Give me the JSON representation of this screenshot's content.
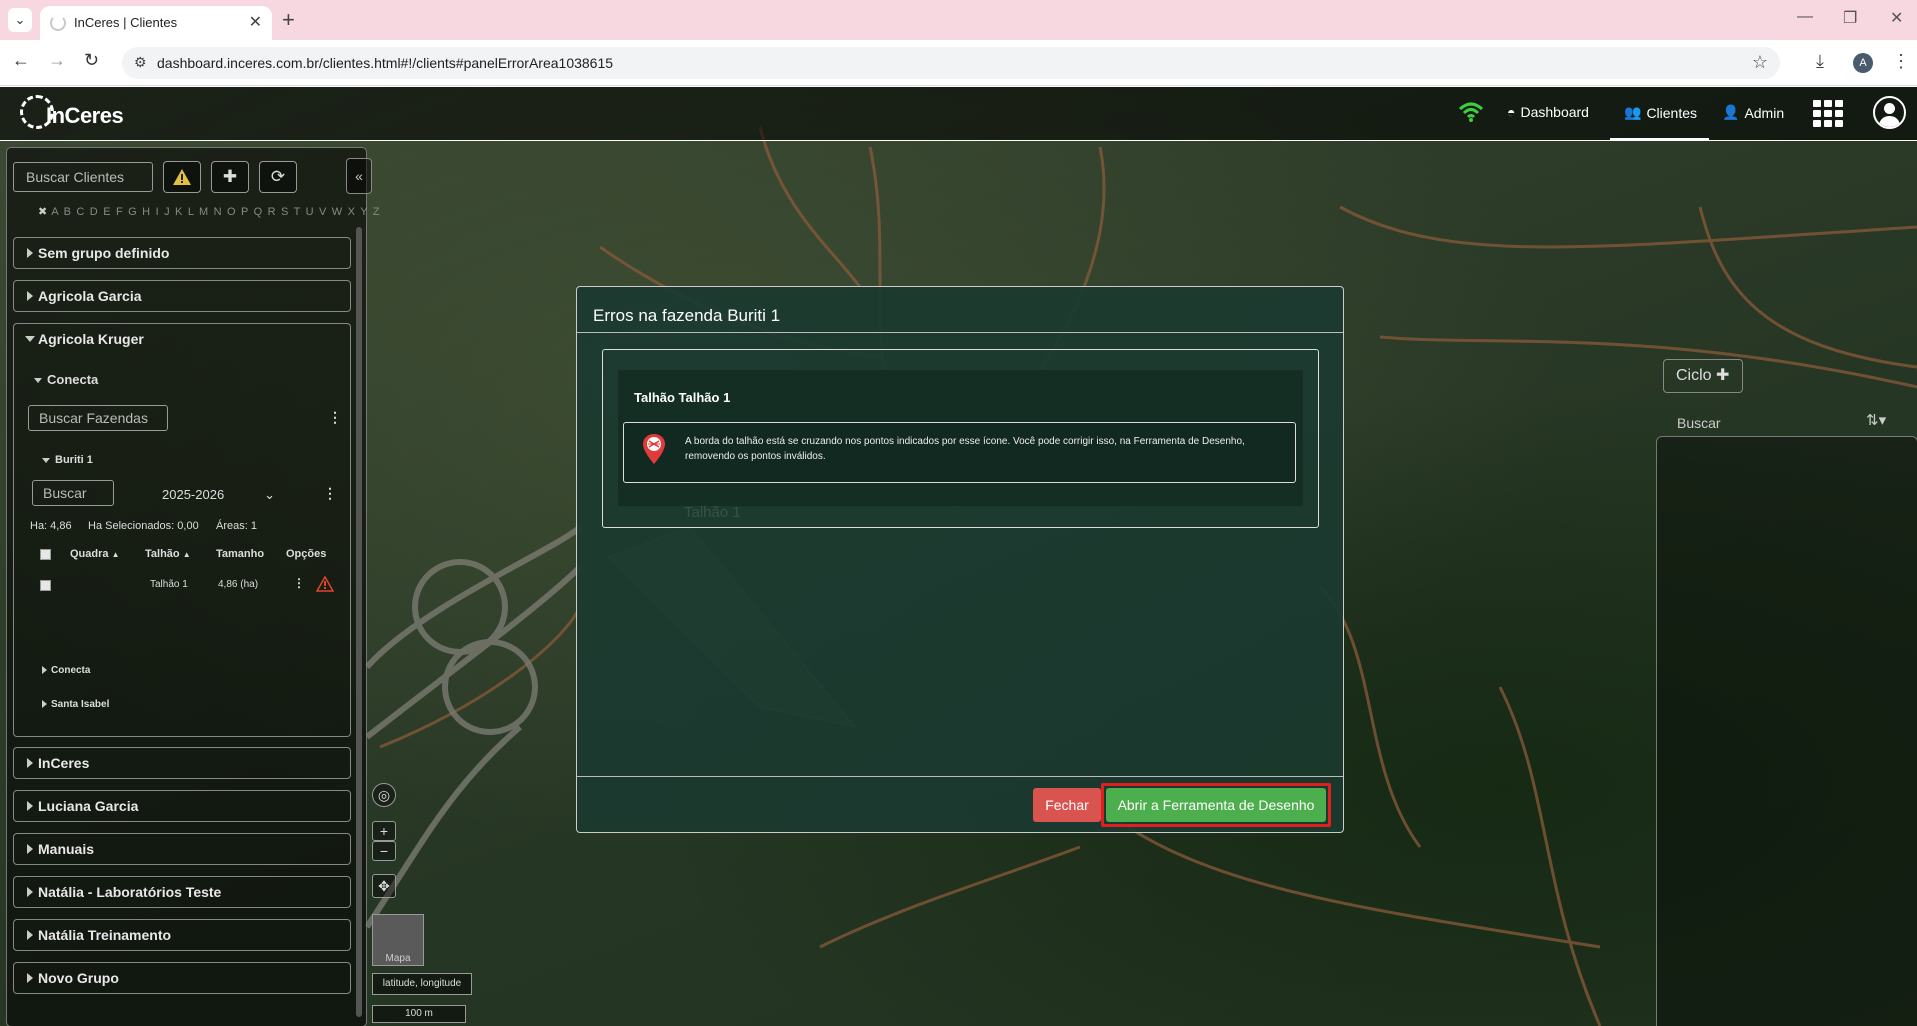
{
  "browser": {
    "tab_title": "InCeres | Clientes",
    "url": "dashboard.inceres.com.br/clientes.html#!/clients#panelErrorArea1038615",
    "profile_initial": "A"
  },
  "app": {
    "logo_text": "InCeres",
    "nav": {
      "dashboard": "Dashboard",
      "clientes": "Clientes",
      "admin": "Admin"
    }
  },
  "sidebar": {
    "search_placeholder": "Buscar Clientes",
    "alphabet": "A B C D E F G H I J K L M N O P Q R S T U V W X Y Z",
    "groups": [
      {
        "label": "Sem grupo definido"
      },
      {
        "label": "Agricola Garcia"
      },
      {
        "label": "Agricola Kruger"
      },
      {
        "label": "InCeres"
      },
      {
        "label": "Luciana Garcia"
      },
      {
        "label": "Manuais"
      },
      {
        "label": "Natália - Laboratórios Teste"
      },
      {
        "label": "Natália Treinamento"
      },
      {
        "label": "Novo Grupo"
      }
    ],
    "open_group": {
      "subgroup": "Conecta",
      "farm_search_placeholder": "Buscar Fazendas",
      "farm": "Buriti 1",
      "area_search_placeholder": "Buscar",
      "season": "2025-2026",
      "stats": {
        "ha": "Ha: 4,86",
        "ha_selected": "Ha Selecionados: 0,00",
        "areas": "Áreas: 1"
      },
      "columns": [
        "Quadra",
        "Talhão",
        "Tamanho",
        "Opções"
      ],
      "rows": [
        {
          "quadra": "",
          "talhao": "Talhão 1",
          "tamanho": "4,86 (ha)"
        }
      ],
      "other_farms": [
        "Conecta",
        "Santa Isabel"
      ]
    }
  },
  "right_panel": {
    "ciclo_label": "Ciclo",
    "search_placeholder": "Buscar"
  },
  "map": {
    "layer_label": "Mapa",
    "coords_label": "latitude, longitude",
    "scale_label": "100 m"
  },
  "modal": {
    "title": "Erros na fazenda Buriti 1",
    "field_title": "Talhão Talhão 1",
    "message": "A borda do talhão está se cruzando nos pontos indicados por esse ícone. Você pode corrigir isso, na Ferramenta de Desenho, removendo os pontos inválidos.",
    "background_label": "Talhão 1",
    "close_button": "Fechar",
    "draw_button": "Abrir a Ferramenta de Desenho"
  },
  "colors": {
    "danger": "#d9534f",
    "success": "#4cae4c",
    "highlight": "#e02020",
    "wifi": "#3ecf3e"
  }
}
